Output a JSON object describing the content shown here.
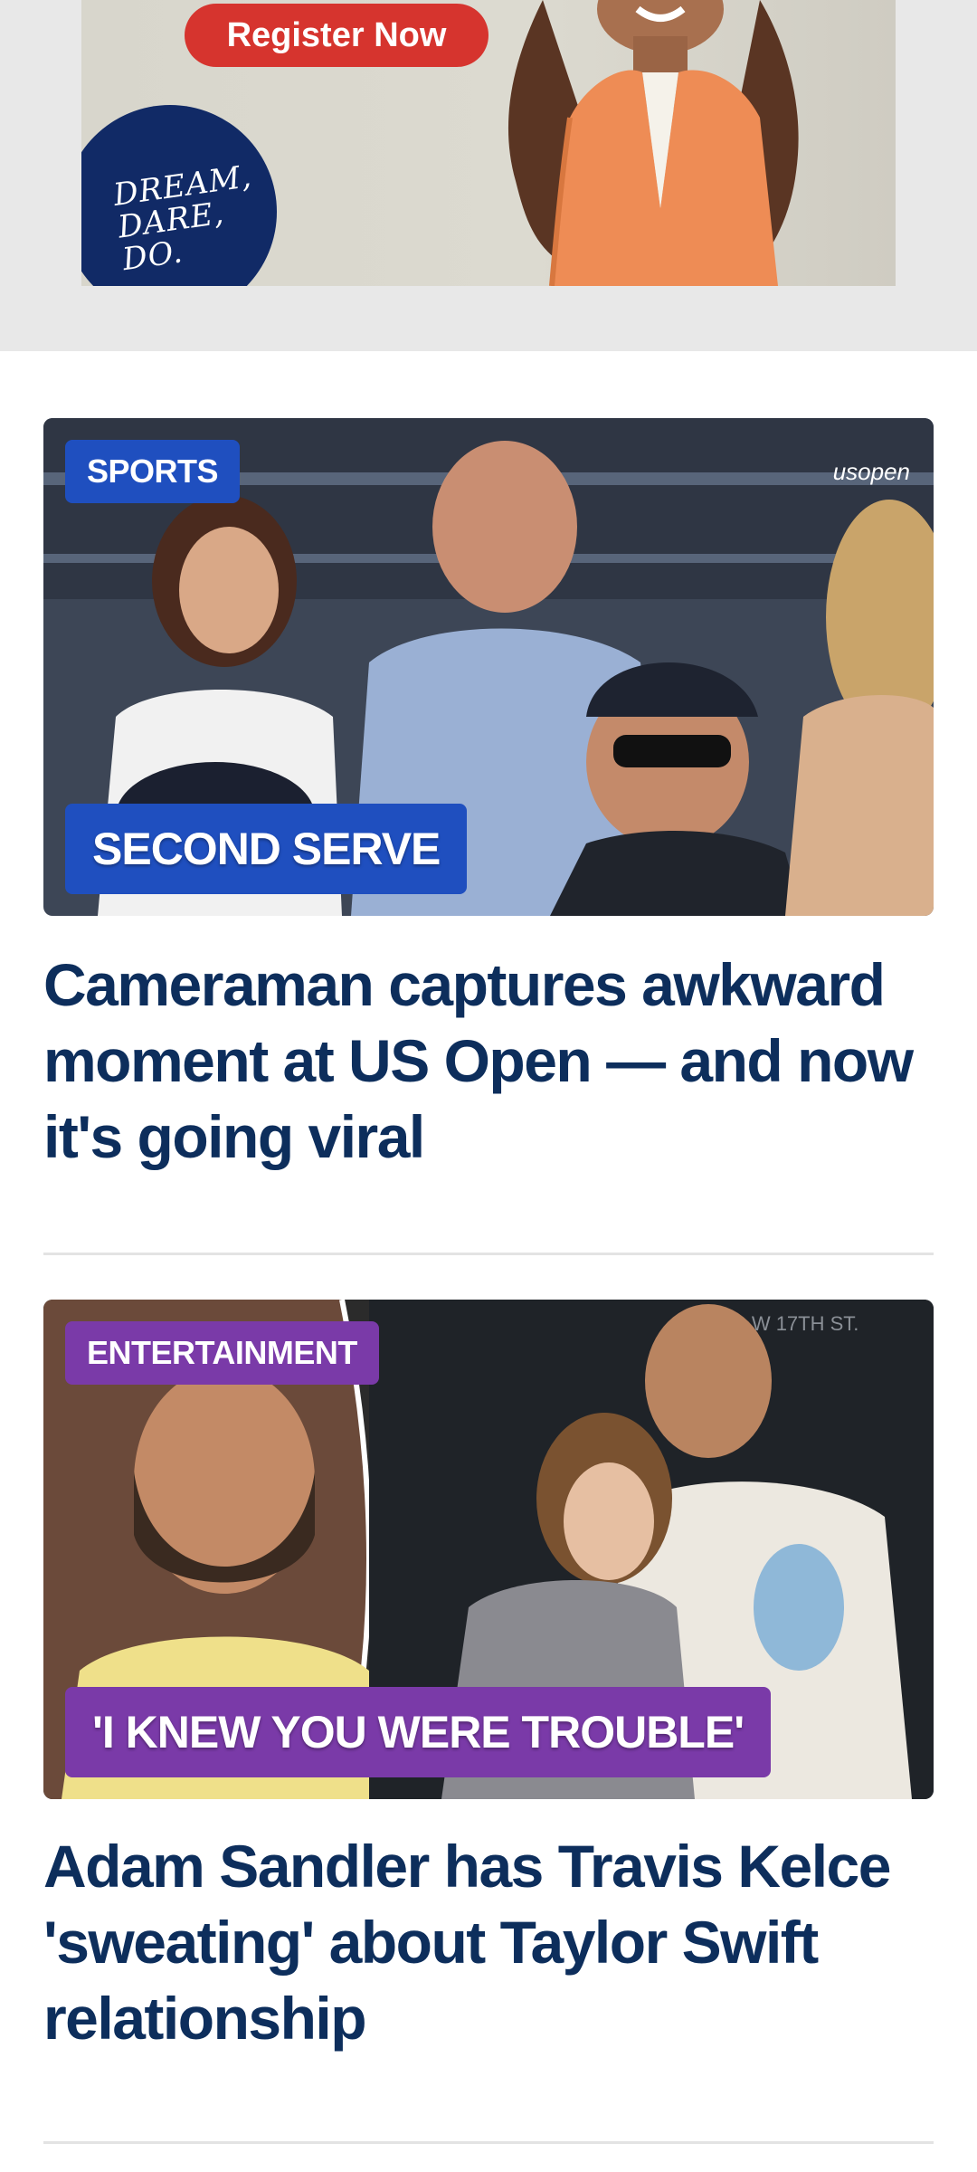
{
  "ad": {
    "button_label": "Register Now",
    "badge_text": "DREAM, DARE, DO.",
    "colors": {
      "button": "#d6342e",
      "badge": "#112a66",
      "jacket": "#ee8c55"
    }
  },
  "articles": [
    {
      "category": "SPORTS",
      "caption": "SECOND SERVE",
      "image_watermark": "usopen",
      "headline": "Cameraman captures awkward moment at US Open — and now it's going viral",
      "tag_color": "#1f4fbf"
    },
    {
      "category": "ENTERTAINMENT",
      "caption": "'I KNEW YOU WERE TROUBLE'",
      "image_sign": "361 W 17TH ST.",
      "headline": "Adam Sandler has Travis Kelce 'sweating' about Taylor Swift relationship",
      "tag_color": "#7a3aa8"
    }
  ],
  "colors": {
    "headline": "#0d2e5c",
    "divider": "#e3e3e3"
  }
}
